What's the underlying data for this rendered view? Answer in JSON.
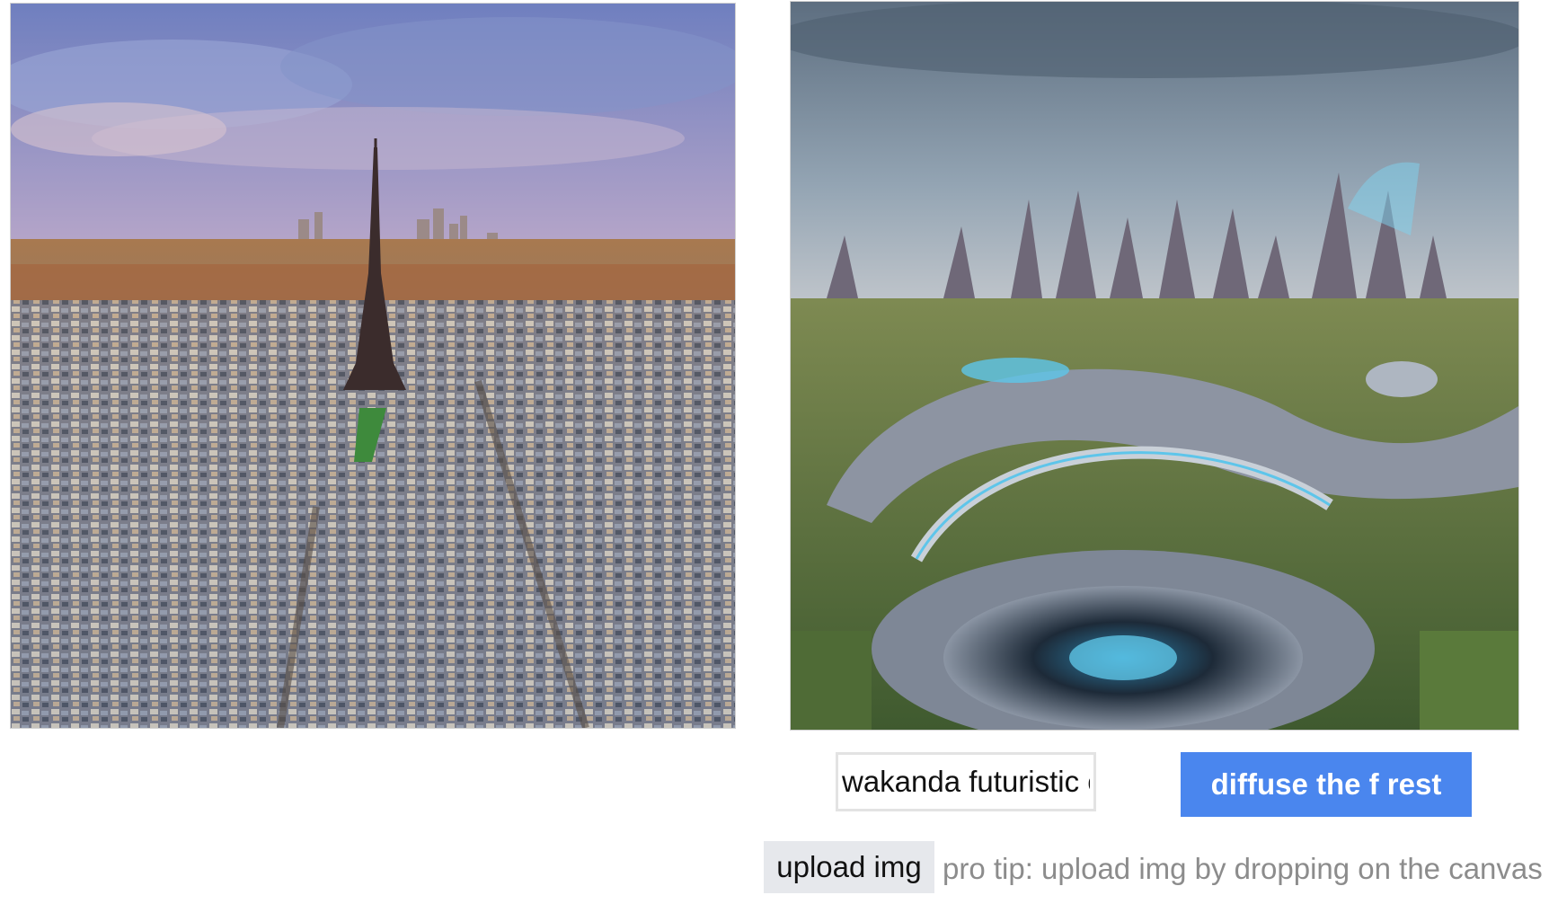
{
  "prompt": {
    "value": "wakanda futuristic city"
  },
  "buttons": {
    "diffuse_label": "diffuse the f rest",
    "upload_label": "upload img"
  },
  "tip": "pro tip: upload img by dropping on the canvas",
  "colors": {
    "accent": "#4a86ee",
    "upload_bg": "#e6e8ec",
    "tip_text": "#8c8c8c"
  }
}
